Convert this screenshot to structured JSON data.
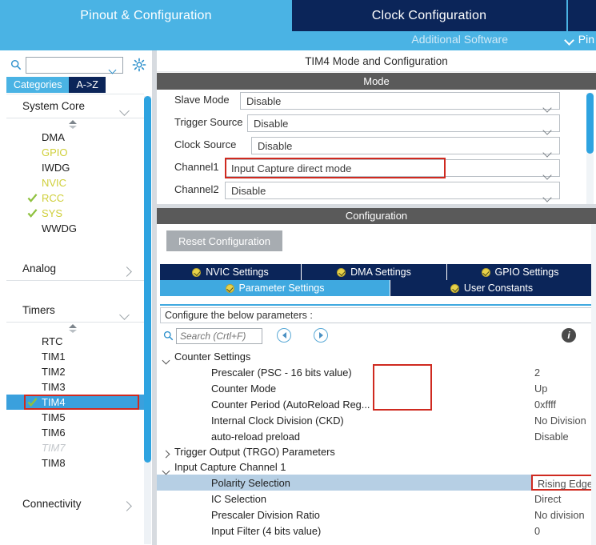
{
  "topbar": {
    "tabs": [
      {
        "label": "Pinout & Configuration",
        "state": "active"
      },
      {
        "label": "Clock Configuration",
        "state": "inactive"
      },
      {
        "label": "",
        "state": "inactive"
      }
    ],
    "additional_software": "Additional Software",
    "pinout_menu": "Pin",
    "colors": {
      "active_tab": "#4ab3e4",
      "inactive_tab": "#0b2559"
    }
  },
  "sidebar": {
    "search_value": "",
    "gear_icon": "gear-icon",
    "mode_tabs": [
      {
        "label": "Categories",
        "selected": true
      },
      {
        "label": "A->Z",
        "selected": false
      }
    ],
    "groups": [
      {
        "label": "System Core",
        "expanded": true,
        "items": [
          {
            "label": "DMA",
            "state": "normal",
            "checked": false
          },
          {
            "label": "GPIO",
            "state": "partial",
            "checked": false
          },
          {
            "label": "IWDG",
            "state": "normal",
            "checked": false
          },
          {
            "label": "NVIC",
            "state": "partial",
            "checked": false
          },
          {
            "label": "RCC",
            "state": "partial",
            "checked": true
          },
          {
            "label": "SYS",
            "state": "partial",
            "checked": true
          },
          {
            "label": "WWDG",
            "state": "normal",
            "checked": false
          }
        ]
      },
      {
        "label": "Analog",
        "expanded": false,
        "items": []
      },
      {
        "label": "Timers",
        "expanded": true,
        "items": [
          {
            "label": "RTC",
            "state": "normal",
            "checked": false
          },
          {
            "label": "TIM1",
            "state": "normal",
            "checked": false
          },
          {
            "label": "TIM2",
            "state": "normal",
            "checked": false
          },
          {
            "label": "TIM3",
            "state": "normal",
            "checked": false
          },
          {
            "label": "TIM4",
            "state": "selected",
            "checked": true,
            "annotated": true
          },
          {
            "label": "TIM5",
            "state": "normal",
            "checked": false
          },
          {
            "label": "TIM6",
            "state": "normal",
            "checked": false
          },
          {
            "label": "TIM7",
            "state": "disabled",
            "checked": false
          },
          {
            "label": "TIM8",
            "state": "normal",
            "checked": false
          }
        ]
      },
      {
        "label": "Connectivity",
        "expanded": false,
        "items": []
      }
    ]
  },
  "panel": {
    "title": "TIM4 Mode and Configuration",
    "mode_band": "Mode",
    "config_band": "Configuration",
    "mode_fields": [
      {
        "label": "Slave Mode",
        "value": "Disable",
        "annotated": false
      },
      {
        "label": "Trigger Source",
        "value": "Disable",
        "annotated": false
      },
      {
        "label": "Clock Source",
        "value": "Disable",
        "annotated": false
      },
      {
        "label": "Channel1",
        "value": "Input Capture direct mode",
        "annotated": true
      },
      {
        "label": "Channel2",
        "value": "Disable",
        "annotated": false
      }
    ],
    "reset_button": "Reset Configuration",
    "config_tabs_row1": [
      {
        "label": "NVIC Settings",
        "active": false
      },
      {
        "label": "DMA Settings",
        "active": false
      },
      {
        "label": "GPIO Settings",
        "active": false
      }
    ],
    "config_tabs_row2": [
      {
        "label": "Parameter Settings",
        "active": true
      },
      {
        "label": "User Constants",
        "active": false
      }
    ],
    "configure_note": "Configure the below parameters :",
    "search_placeholder": "Search (Crtl+F)",
    "search_value": "",
    "info_icon": "info-icon",
    "param_groups": [
      {
        "label": "Counter Settings",
        "expanded": true,
        "rows": [
          {
            "name": "Prescaler (PSC - 16 bits value)",
            "value": "2",
            "highlighted": false
          },
          {
            "name": "Counter Mode",
            "value": "Up",
            "highlighted": false
          },
          {
            "name": "Counter Period (AutoReload Reg...",
            "value": "0xffff",
            "highlighted": false
          },
          {
            "name": "Internal Clock Division (CKD)",
            "value": "No Division",
            "highlighted": false
          },
          {
            "name": "auto-reload preload",
            "value": "Disable",
            "highlighted": false
          }
        ]
      },
      {
        "label": "Trigger Output (TRGO) Parameters",
        "expanded": false,
        "rows": []
      },
      {
        "label": "Input Capture Channel 1",
        "expanded": true,
        "rows": [
          {
            "name": "Polarity Selection",
            "value": "Rising Edge",
            "highlighted": true,
            "annotated": true,
            "dropdown": true
          },
          {
            "name": "IC Selection",
            "value": "Direct",
            "highlighted": false
          },
          {
            "name": "Prescaler Division Ratio",
            "value": "No division",
            "highlighted": false
          },
          {
            "name": "Input Filter (4 bits value)",
            "value": "0",
            "highlighted": false
          }
        ]
      }
    ],
    "annotation_color": "#cf2a20"
  }
}
